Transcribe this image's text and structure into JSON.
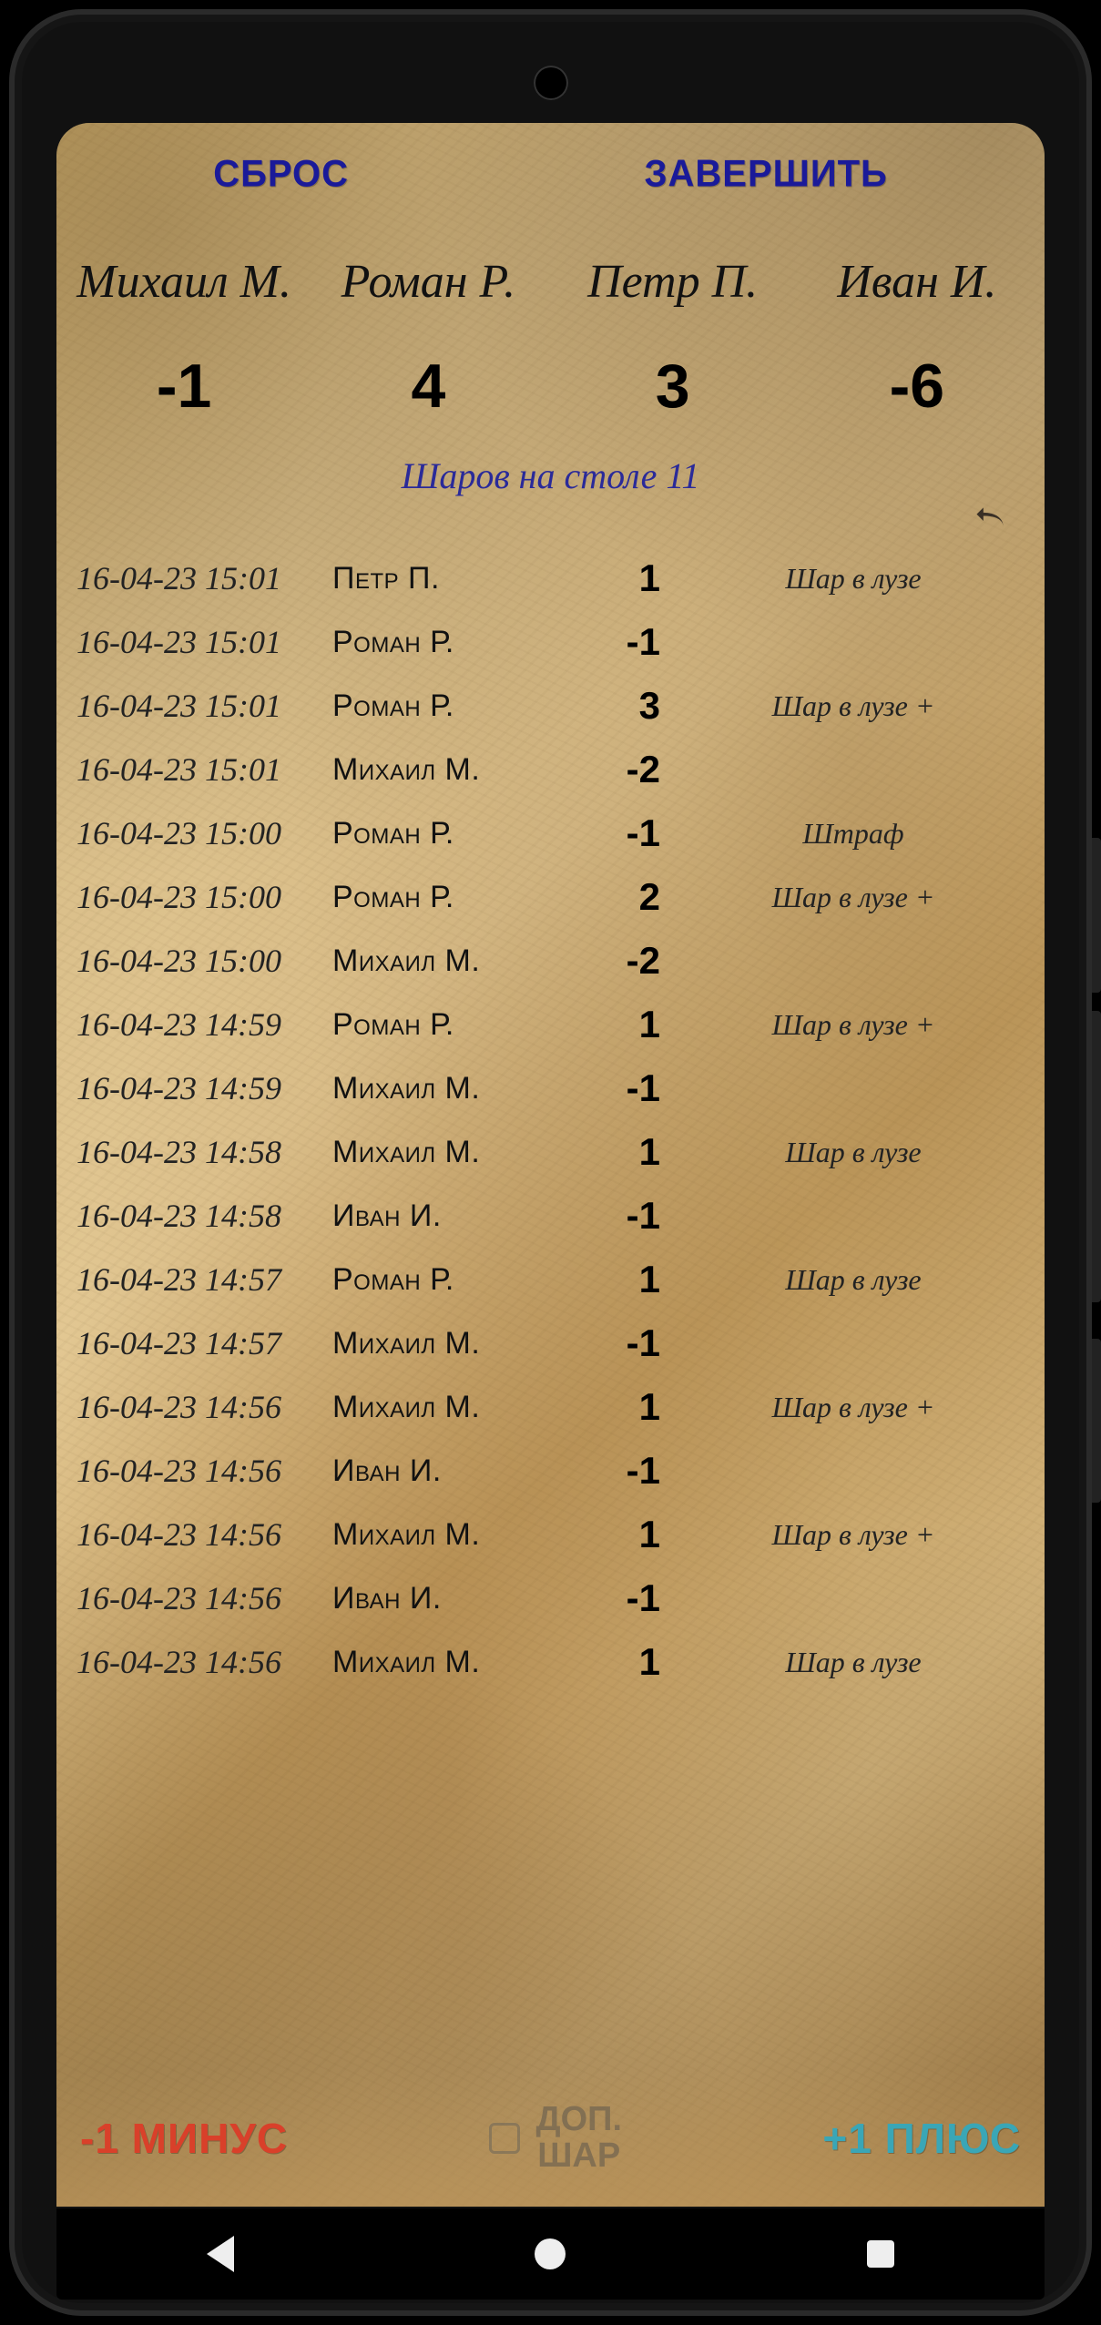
{
  "topbar": {
    "reset_label": "СБРОС",
    "finish_label": "ЗАВЕРШИТЬ"
  },
  "players": [
    {
      "name": "Михаил М.",
      "score": "-1"
    },
    {
      "name": "Роман Р.",
      "score": "4"
    },
    {
      "name": "Петр П.",
      "score": "3"
    },
    {
      "name": "Иван И.",
      "score": "-6"
    }
  ],
  "balls_on_table": "Шаров на столе 11",
  "log": [
    {
      "ts": "16-04-23 15:01",
      "player": "Петр П.",
      "delta": "1",
      "note": "Шар в лузе"
    },
    {
      "ts": "16-04-23 15:01",
      "player": "Роман Р.",
      "delta": "-1",
      "note": ""
    },
    {
      "ts": "16-04-23 15:01",
      "player": "Роман Р.",
      "delta": "3",
      "note": "Шар в лузе +"
    },
    {
      "ts": "16-04-23 15:01",
      "player": "Михаил М.",
      "delta": "-2",
      "note": ""
    },
    {
      "ts": "16-04-23 15:00",
      "player": "Роман Р.",
      "delta": "-1",
      "note": "Штраф"
    },
    {
      "ts": "16-04-23 15:00",
      "player": "Роман Р.",
      "delta": "2",
      "note": "Шар в лузе +"
    },
    {
      "ts": "16-04-23 15:00",
      "player": "Михаил М.",
      "delta": "-2",
      "note": ""
    },
    {
      "ts": "16-04-23 14:59",
      "player": "Роман Р.",
      "delta": "1",
      "note": "Шар в лузе +"
    },
    {
      "ts": "16-04-23 14:59",
      "player": "Михаил М.",
      "delta": "-1",
      "note": ""
    },
    {
      "ts": "16-04-23 14:58",
      "player": "Михаил М.",
      "delta": "1",
      "note": "Шар в лузе"
    },
    {
      "ts": "16-04-23 14:58",
      "player": "Иван И.",
      "delta": "-1",
      "note": ""
    },
    {
      "ts": "16-04-23 14:57",
      "player": "Роман Р.",
      "delta": "1",
      "note": "Шар в лузе"
    },
    {
      "ts": "16-04-23 14:57",
      "player": "Михаил М.",
      "delta": "-1",
      "note": ""
    },
    {
      "ts": "16-04-23 14:56",
      "player": "Михаил М.",
      "delta": "1",
      "note": "Шар в лузе +"
    },
    {
      "ts": "16-04-23 14:56",
      "player": "Иван И.",
      "delta": "-1",
      "note": ""
    },
    {
      "ts": "16-04-23 14:56",
      "player": "Михаил М.",
      "delta": "1",
      "note": "Шар в лузе +"
    },
    {
      "ts": "16-04-23 14:56",
      "player": "Иван И.",
      "delta": "-1",
      "note": ""
    },
    {
      "ts": "16-04-23 14:56",
      "player": "Михаил М.",
      "delta": "1",
      "note": "Шар в лузе"
    }
  ],
  "bottombar": {
    "minus_label": "-1 МИНУС",
    "extra_ball_label_line1": "ДОП.",
    "extra_ball_label_line2": "ШАР",
    "plus_label": "+1 ПЛЮС"
  },
  "colors": {
    "accent_blue": "#1a1a99",
    "minus_red": "#d9402a",
    "plus_teal": "#3aa6b6"
  }
}
